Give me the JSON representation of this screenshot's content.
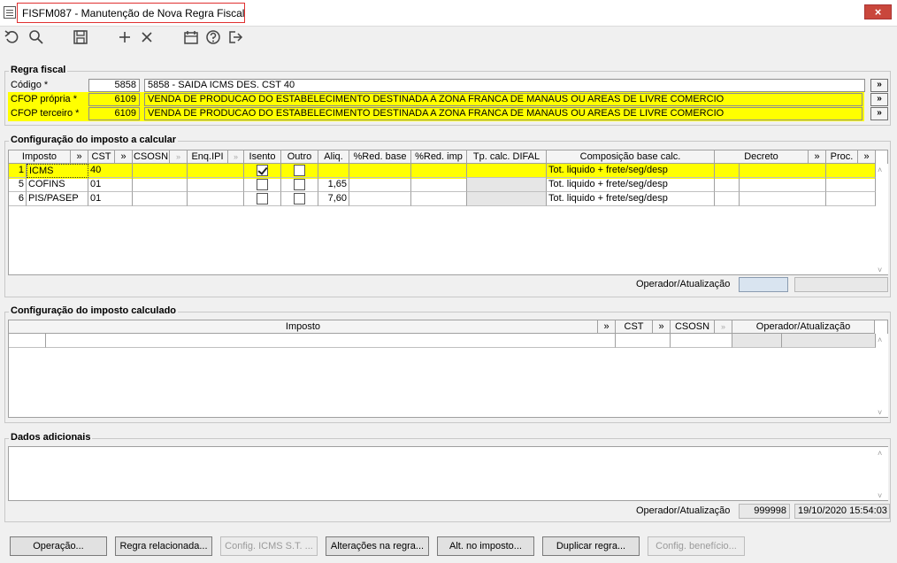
{
  "window": {
    "title": "FISFM087 - Manutenção de Nova Regra Fiscal",
    "close_symbol": "×"
  },
  "toolbar": {
    "icons": [
      "undo-icon",
      "search-icon",
      "save-icon",
      "add-icon",
      "delete-icon",
      "calendar-icon",
      "help-icon",
      "exit-icon"
    ]
  },
  "regra": {
    "title": "Regra fiscal",
    "codigo_label": "Código *",
    "codigo_value": "5858",
    "codigo_desc": "5858 - SAIDA ICMS DES. CST 40",
    "cfop_propria_label": "CFOP própria *",
    "cfop_propria_value": "6109",
    "cfop_propria_desc": "VENDA DE PRODUCAO DO ESTABELECIMENTO DESTINADA A ZONA FRANCA DE MANAUS OU AREAS DE LIVRE COMERCIO",
    "cfop_terceiro_label": "CFOP terceiro *",
    "cfop_terceiro_value": "6109",
    "cfop_terceiro_desc": "VENDA DE PRODUCAO DO ESTABELECIMENTO DESTINADA A ZONA FRANCA DE MANAUS OU AREAS DE LIVRE COMERCIO",
    "more": "»"
  },
  "calc": {
    "title": "Configuração do imposto a calcular",
    "headers": {
      "imposto": "Imposto",
      "cst": "CST",
      "csosn": "CSOSN",
      "enq_ipi": "Enq.IPI",
      "isento": "Isento",
      "outro": "Outro",
      "aliq": "Aliq.",
      "red_base": "%Red. base",
      "red_imp": "%Red. imp",
      "tp_calc": "Tp. calc. DIFAL",
      "composicao": "Composição base calc.",
      "decreto": "Decreto",
      "proc": "Proc.",
      "more": "»"
    },
    "rows": [
      {
        "num": "1",
        "imposto": "ICMS",
        "cst": "40",
        "isento": true,
        "outro": false,
        "aliq": "",
        "composicao": "Tot. liquido + frete/seg/desp"
      },
      {
        "num": "5",
        "imposto": "COFINS",
        "cst": "01",
        "isento": false,
        "outro": false,
        "aliq": "1,65",
        "composicao": "Tot. liquido + frete/seg/desp"
      },
      {
        "num": "6",
        "imposto": "PIS/PASEP",
        "cst": "01",
        "isento": false,
        "outro": false,
        "aliq": "7,60",
        "composicao": "Tot. liquido + frete/seg/desp"
      }
    ],
    "operador_label": "Operador/Atualização",
    "operador_value": "",
    "data_value": ""
  },
  "calculado": {
    "title": "Configuração do imposto calculado",
    "headers": {
      "imposto": "Imposto",
      "cst": "CST",
      "csosn": "CSOSN",
      "operador": "Operador/Atualização",
      "more": "»"
    }
  },
  "dados": {
    "title": "Dados adicionais",
    "operador_label": "Operador/Atualização",
    "operador_value": "999998",
    "data_value": "19/10/2020 15:54:03"
  },
  "buttons": {
    "operacao": "Operação...",
    "regra_relacionada": "Regra relacionada...",
    "config_icms": "Config. ICMS S.T. ...",
    "alteracoes": "Alterações na regra...",
    "alt_imposto": "Alt. no imposto...",
    "duplicar": "Duplicar regra...",
    "config_beneficio": "Config. benefício..."
  }
}
